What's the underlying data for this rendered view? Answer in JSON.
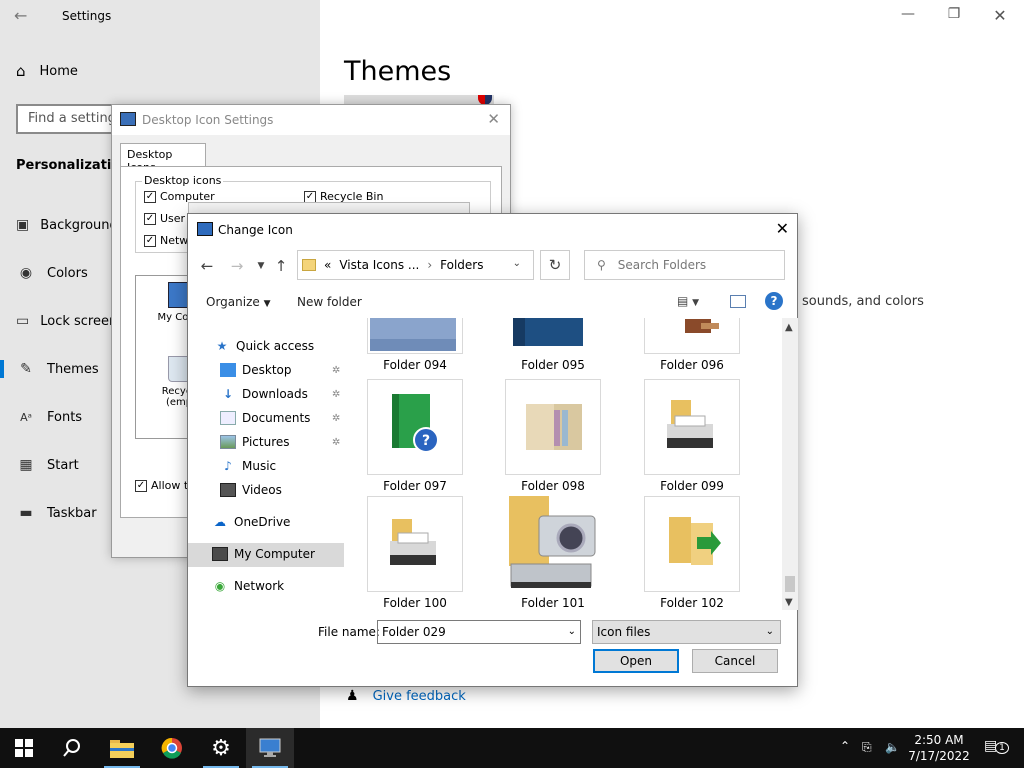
{
  "settings": {
    "window_title": "Settings",
    "home_label": "Home",
    "search_placeholder": "Find a setting",
    "section_label": "Personalization",
    "nav": [
      {
        "label": "Background",
        "icon": "image-icon"
      },
      {
        "label": "Colors",
        "icon": "palette-icon"
      },
      {
        "label": "Lock screen",
        "icon": "lock-screen-icon"
      },
      {
        "label": "Themes",
        "icon": "brush-icon"
      },
      {
        "label": "Fonts",
        "icon": "font-icon"
      },
      {
        "label": "Start",
        "icon": "start-icon"
      },
      {
        "label": "Taskbar",
        "icon": "taskbar-icon"
      }
    ],
    "active_nav": "Themes",
    "page_heading": "Themes",
    "partial_text": "sounds, and colors",
    "feedback_label": "Give feedback"
  },
  "desktop_icon_settings": {
    "title": "Desktop Icon Settings",
    "tab_label": "Desktop Icons",
    "group_label": "Desktop icons",
    "checkboxes": [
      {
        "label": "Computer",
        "checked": true
      },
      {
        "label": "User",
        "checked": true
      },
      {
        "label": "Netw",
        "checked": true
      },
      {
        "label": "Recycle Bin",
        "checked": true
      }
    ],
    "icon_items": [
      "My Comp",
      "Recycle",
      "(empt"
    ],
    "allow_label": "Allow t"
  },
  "change_icon": {
    "title": "Change Icon",
    "breadcrumb": [
      "Vista Icons ...",
      "Folders"
    ],
    "breadcrumb_prefix": "«",
    "search_placeholder": "Search Folders",
    "organize_label": "Organize",
    "new_folder_label": "New folder",
    "nav_items": [
      {
        "label": "Quick access",
        "icon": "star-icon",
        "pinned": false
      },
      {
        "label": "Desktop",
        "icon": "desktop-icon",
        "pinned": true
      },
      {
        "label": "Downloads",
        "icon": "download-icon",
        "pinned": true
      },
      {
        "label": "Documents",
        "icon": "document-icon",
        "pinned": true
      },
      {
        "label": "Pictures",
        "icon": "picture-icon",
        "pinned": true
      },
      {
        "label": "Music",
        "icon": "music-icon",
        "pinned": false
      },
      {
        "label": "Videos",
        "icon": "video-icon",
        "pinned": false
      },
      {
        "label": "OneDrive",
        "icon": "cloud-icon",
        "pinned": false
      },
      {
        "label": "My Computer",
        "icon": "computer-icon",
        "pinned": false
      },
      {
        "label": "Network",
        "icon": "network-icon",
        "pinned": false
      }
    ],
    "selected_nav": "My Computer",
    "files": [
      {
        "name": "Folder 094",
        "icon": "blue-folder-icon"
      },
      {
        "name": "Folder 095",
        "icon": "blue-book-icon"
      },
      {
        "name": "Folder 096",
        "icon": "brown-folder-icon"
      },
      {
        "name": "Folder 097",
        "icon": "green-book-help-icon"
      },
      {
        "name": "Folder 098",
        "icon": "open-book-icon"
      },
      {
        "name": "Folder 099",
        "icon": "folder-printer-icon"
      },
      {
        "name": "Folder 100",
        "icon": "folder-printer-icon"
      },
      {
        "name": "Folder 101",
        "icon": "folder-scanner-camera-icon"
      },
      {
        "name": "Folder 102",
        "icon": "folder-arrow-icon"
      }
    ],
    "file_name_label": "File name:",
    "file_name_value": "Folder 029",
    "file_type_value": "Icon files",
    "open_label": "Open",
    "cancel_label": "Cancel",
    "accent_color": "#0078d4"
  },
  "taskbar": {
    "apps": [
      "start-icon",
      "search-icon",
      "file-explorer-icon",
      "chrome-icon",
      "settings-gear-icon",
      "desktop-icon-settings-app-icon"
    ],
    "time": "2:50 AM",
    "date": "7/17/2022",
    "notification_count": "1"
  }
}
